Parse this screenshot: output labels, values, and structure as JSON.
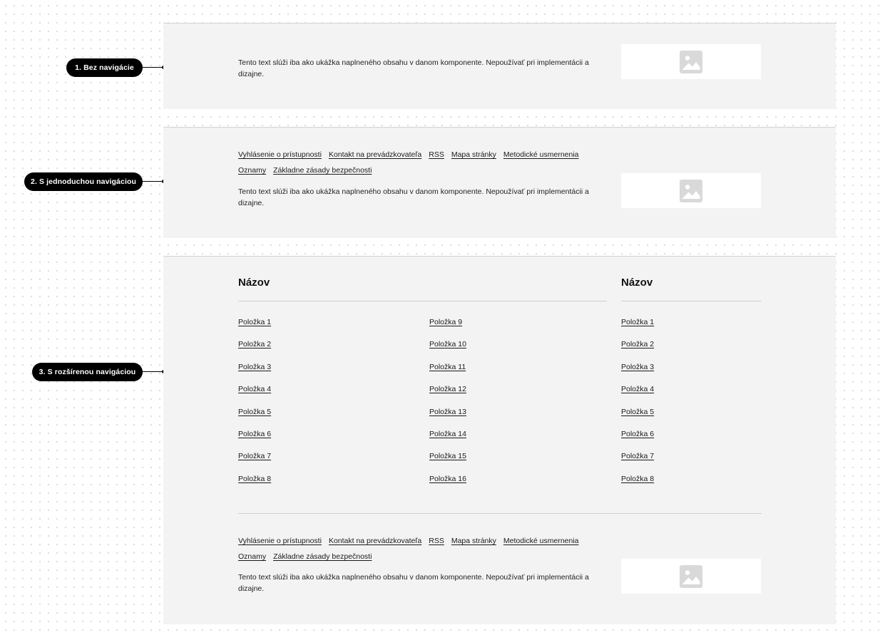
{
  "annotations": [
    {
      "label": "1. Bez navigácie"
    },
    {
      "label": "2. S jednoduchou navigáciou"
    },
    {
      "label": "3. S rozšírenou navigáciou"
    }
  ],
  "description_text": "Tento text slúži iba ako ukážka naplneného obsahu v danom komponente. Nepoužívať pri implementácii a dizajne.",
  "nav_links": {
    "row1": [
      "Vyhlásenie o prístupnosti",
      "Kontakt na prevádzkovateľa",
      "RSS",
      "Mapa stránky",
      "Metodické usmernenia"
    ],
    "row2": [
      "Oznamy",
      "Základne zásady bezpečnosti"
    ]
  },
  "extended_nav": {
    "column_left": {
      "title": "Názov",
      "items_a": [
        "Položka 1",
        "Položka 2",
        "Položka 3",
        "Položka 4",
        "Položka 5",
        "Položka 6",
        "Položka 7",
        "Položka 8"
      ],
      "items_b": [
        "Položka 9",
        "Položka 10",
        "Položka 11",
        "Položka 12",
        "Položka 13",
        "Položka 14",
        "Položka 15",
        "Položka 16"
      ]
    },
    "column_right": {
      "title": "Názov",
      "items": [
        "Položka 1",
        "Položka 2",
        "Položka 3",
        "Položka 4",
        "Položka 5",
        "Položka 6",
        "Položka 7",
        "Položka 8"
      ]
    }
  },
  "icons": {
    "placeholder": "image-placeholder-icon"
  },
  "colors": {
    "pill_background": "#000000",
    "panel_background": "#f3f3f3",
    "placeholder_icon": "#d9d9d9"
  }
}
